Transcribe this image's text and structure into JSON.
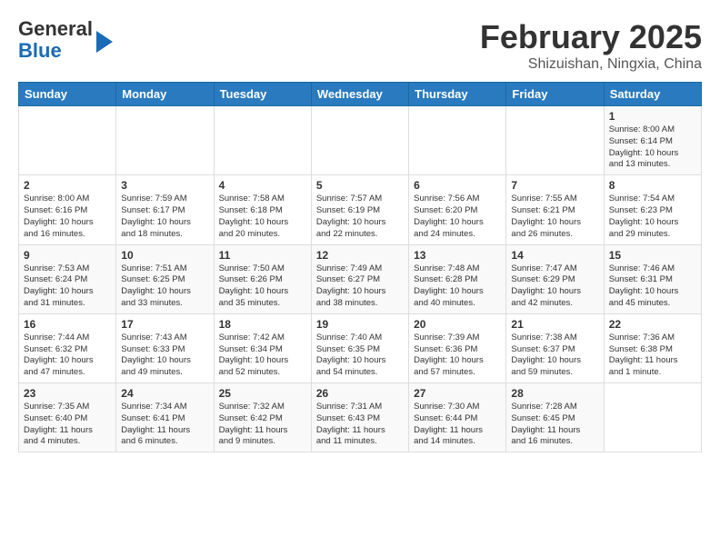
{
  "header": {
    "logo_line1": "General",
    "logo_line2": "Blue",
    "month": "February 2025",
    "location": "Shizuishan, Ningxia, China"
  },
  "weekdays": [
    "Sunday",
    "Monday",
    "Tuesday",
    "Wednesday",
    "Thursday",
    "Friday",
    "Saturday"
  ],
  "weeks": [
    [
      {
        "day": "",
        "info": ""
      },
      {
        "day": "",
        "info": ""
      },
      {
        "day": "",
        "info": ""
      },
      {
        "day": "",
        "info": ""
      },
      {
        "day": "",
        "info": ""
      },
      {
        "day": "",
        "info": ""
      },
      {
        "day": "1",
        "info": "Sunrise: 8:00 AM\nSunset: 6:14 PM\nDaylight: 10 hours\nand 13 minutes."
      }
    ],
    [
      {
        "day": "2",
        "info": "Sunrise: 8:00 AM\nSunset: 6:16 PM\nDaylight: 10 hours\nand 16 minutes."
      },
      {
        "day": "3",
        "info": "Sunrise: 7:59 AM\nSunset: 6:17 PM\nDaylight: 10 hours\nand 18 minutes."
      },
      {
        "day": "4",
        "info": "Sunrise: 7:58 AM\nSunset: 6:18 PM\nDaylight: 10 hours\nand 20 minutes."
      },
      {
        "day": "5",
        "info": "Sunrise: 7:57 AM\nSunset: 6:19 PM\nDaylight: 10 hours\nand 22 minutes."
      },
      {
        "day": "6",
        "info": "Sunrise: 7:56 AM\nSunset: 6:20 PM\nDaylight: 10 hours\nand 24 minutes."
      },
      {
        "day": "7",
        "info": "Sunrise: 7:55 AM\nSunset: 6:21 PM\nDaylight: 10 hours\nand 26 minutes."
      },
      {
        "day": "8",
        "info": "Sunrise: 7:54 AM\nSunset: 6:23 PM\nDaylight: 10 hours\nand 29 minutes."
      }
    ],
    [
      {
        "day": "9",
        "info": "Sunrise: 7:53 AM\nSunset: 6:24 PM\nDaylight: 10 hours\nand 31 minutes."
      },
      {
        "day": "10",
        "info": "Sunrise: 7:51 AM\nSunset: 6:25 PM\nDaylight: 10 hours\nand 33 minutes."
      },
      {
        "day": "11",
        "info": "Sunrise: 7:50 AM\nSunset: 6:26 PM\nDaylight: 10 hours\nand 35 minutes."
      },
      {
        "day": "12",
        "info": "Sunrise: 7:49 AM\nSunset: 6:27 PM\nDaylight: 10 hours\nand 38 minutes."
      },
      {
        "day": "13",
        "info": "Sunrise: 7:48 AM\nSunset: 6:28 PM\nDaylight: 10 hours\nand 40 minutes."
      },
      {
        "day": "14",
        "info": "Sunrise: 7:47 AM\nSunset: 6:29 PM\nDaylight: 10 hours\nand 42 minutes."
      },
      {
        "day": "15",
        "info": "Sunrise: 7:46 AM\nSunset: 6:31 PM\nDaylight: 10 hours\nand 45 minutes."
      }
    ],
    [
      {
        "day": "16",
        "info": "Sunrise: 7:44 AM\nSunset: 6:32 PM\nDaylight: 10 hours\nand 47 minutes."
      },
      {
        "day": "17",
        "info": "Sunrise: 7:43 AM\nSunset: 6:33 PM\nDaylight: 10 hours\nand 49 minutes."
      },
      {
        "day": "18",
        "info": "Sunrise: 7:42 AM\nSunset: 6:34 PM\nDaylight: 10 hours\nand 52 minutes."
      },
      {
        "day": "19",
        "info": "Sunrise: 7:40 AM\nSunset: 6:35 PM\nDaylight: 10 hours\nand 54 minutes."
      },
      {
        "day": "20",
        "info": "Sunrise: 7:39 AM\nSunset: 6:36 PM\nDaylight: 10 hours\nand 57 minutes."
      },
      {
        "day": "21",
        "info": "Sunrise: 7:38 AM\nSunset: 6:37 PM\nDaylight: 10 hours\nand 59 minutes."
      },
      {
        "day": "22",
        "info": "Sunrise: 7:36 AM\nSunset: 6:38 PM\nDaylight: 11 hours\nand 1 minute."
      }
    ],
    [
      {
        "day": "23",
        "info": "Sunrise: 7:35 AM\nSunset: 6:40 PM\nDaylight: 11 hours\nand 4 minutes."
      },
      {
        "day": "24",
        "info": "Sunrise: 7:34 AM\nSunset: 6:41 PM\nDaylight: 11 hours\nand 6 minutes."
      },
      {
        "day": "25",
        "info": "Sunrise: 7:32 AM\nSunset: 6:42 PM\nDaylight: 11 hours\nand 9 minutes."
      },
      {
        "day": "26",
        "info": "Sunrise: 7:31 AM\nSunset: 6:43 PM\nDaylight: 11 hours\nand 11 minutes."
      },
      {
        "day": "27",
        "info": "Sunrise: 7:30 AM\nSunset: 6:44 PM\nDaylight: 11 hours\nand 14 minutes."
      },
      {
        "day": "28",
        "info": "Sunrise: 7:28 AM\nSunset: 6:45 PM\nDaylight: 11 hours\nand 16 minutes."
      },
      {
        "day": "",
        "info": ""
      }
    ]
  ]
}
